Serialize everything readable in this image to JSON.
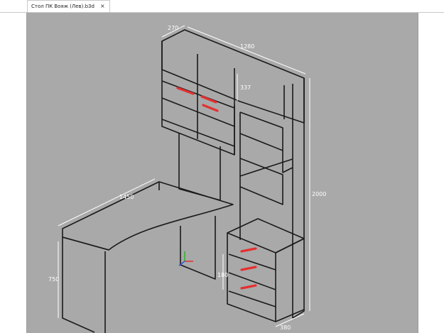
{
  "tab": {
    "title": "Стол ПК Вояж (Лев).b3d",
    "close_glyph": "×"
  },
  "viewport": {
    "background": "#a9a9a9",
    "line_color": "#1a1a1a",
    "handle_color": "#e53030",
    "dimension_color": "#ffffff"
  },
  "dimensions": {
    "top_depth": "270",
    "top_width": "1280",
    "door_height": "337",
    "total_height": "2000",
    "desk_length": "1450",
    "desk_height": "750",
    "drawer_height": "180",
    "pedestal_depth": "380"
  },
  "axes_icon": "coordinate-axes"
}
